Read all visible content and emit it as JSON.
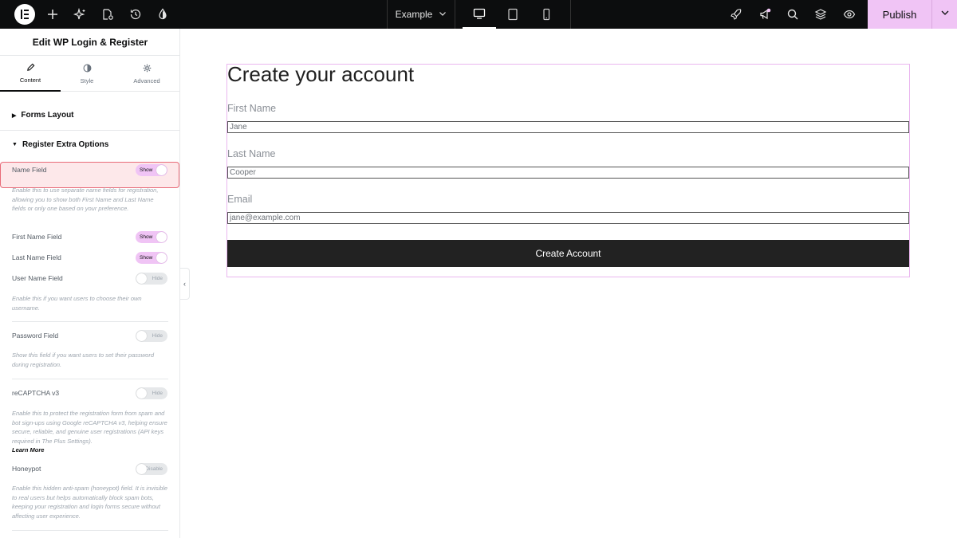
{
  "topbar": {
    "document_name": "Example",
    "publish_label": "Publish"
  },
  "panel": {
    "title": "Edit WP Login & Register",
    "tabs": [
      {
        "label": "Content",
        "icon": "pencil-icon",
        "active": true
      },
      {
        "label": "Style",
        "icon": "half-circle-icon",
        "active": false
      },
      {
        "label": "Advanced",
        "icon": "gear-icon",
        "active": false
      }
    ],
    "sections": {
      "forms_layout": "Forms Layout",
      "register_extra": "Register Extra Options"
    },
    "controls": {
      "name_field": {
        "label": "Name Field",
        "state": "Show",
        "help": "Enable this to use separate name fields for registration, allowing you to show both First Name and Last Name fields or only one based on your preference."
      },
      "first_name_field": {
        "label": "First Name Field",
        "state": "Show"
      },
      "last_name_field": {
        "label": "Last Name Field",
        "state": "Show"
      },
      "user_name_field": {
        "label": "User Name Field",
        "state": "Hide",
        "help": "Enable this if you want users to choose their own usemame."
      },
      "password_field": {
        "label": "Password Field",
        "state": "Hide",
        "help": "Show this field if you want users to set their password during registration."
      },
      "recaptcha": {
        "label": "reCAPTCHA v3",
        "state": "Hide",
        "help": "Enable this to protect the registration form from spam and bot sign-ups using Google reCAPTCHA v3, helping ensure secure, reliable, and genuine user registrations (API keys required in The Plus Settings).",
        "learn_more": "Learn More"
      },
      "honeypot": {
        "label": "Honeypot",
        "state": "Disable",
        "help": "Enable this hidden anti-spam (honeypot) field. It is invisible to real users but helps automatically block spam bots, keeping your registration and login forms secure without affecting user experience."
      }
    }
  },
  "form": {
    "title": "Create your account",
    "fields": [
      {
        "label": "First Name",
        "value": "Jane"
      },
      {
        "label": "Last Name",
        "value": "Cooper"
      },
      {
        "label": "Email",
        "value": "jane@example.com"
      }
    ],
    "submit_label": "Create Account"
  },
  "colors": {
    "accent": "#f0c4f5",
    "topbar": "#0c0d0e",
    "highlight_border": "#e86a78"
  }
}
